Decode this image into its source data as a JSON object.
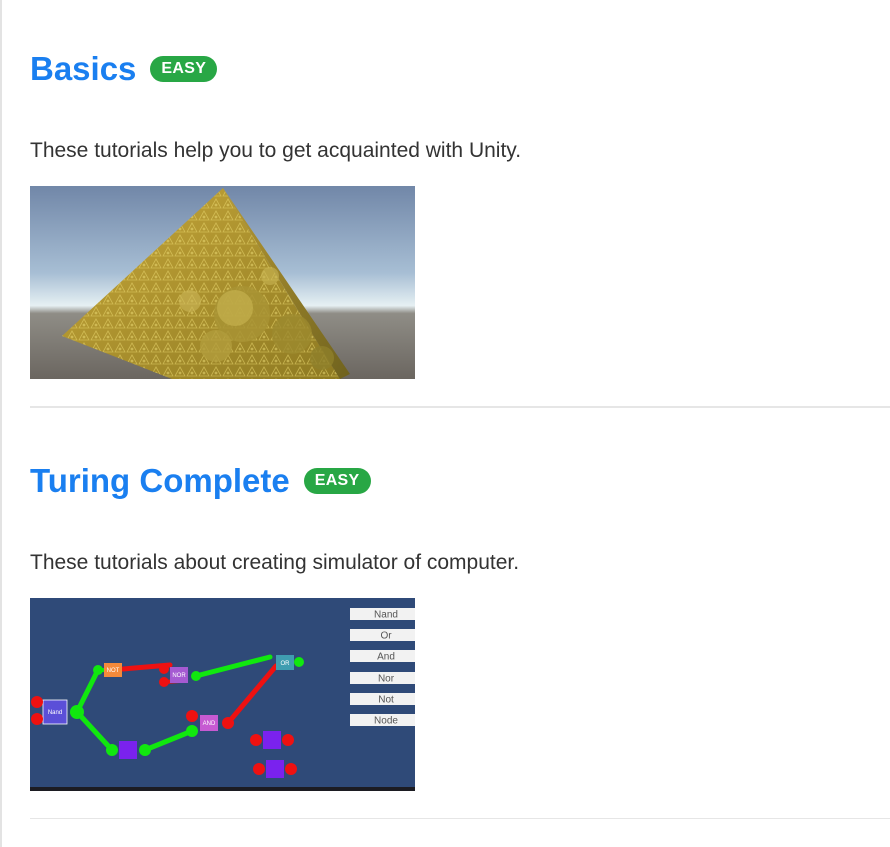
{
  "sections": [
    {
      "title": "Basics",
      "badge": "EASY",
      "description": "These tutorials help you to get acquainted with Unity.",
      "image": "sierpinski-pyramid-thumbnail"
    },
    {
      "title": "Turing Complete",
      "badge": "EASY",
      "description": "These tutorials about creating simulator of computer.",
      "image": "logic-gate-simulator-thumbnail",
      "simulator": {
        "buttons": [
          "Nand",
          "Or",
          "And",
          "Nor",
          "Not",
          "Node"
        ],
        "gates": [
          "NOT",
          "NOR",
          "OR",
          "Nand",
          "AND"
        ]
      }
    }
  ],
  "colors": {
    "title": "#1a7ff0",
    "badge": "#28a745",
    "wire_on": "#11e80f",
    "wire_off": "#ee1111",
    "sim_background": "#2f4a78"
  }
}
